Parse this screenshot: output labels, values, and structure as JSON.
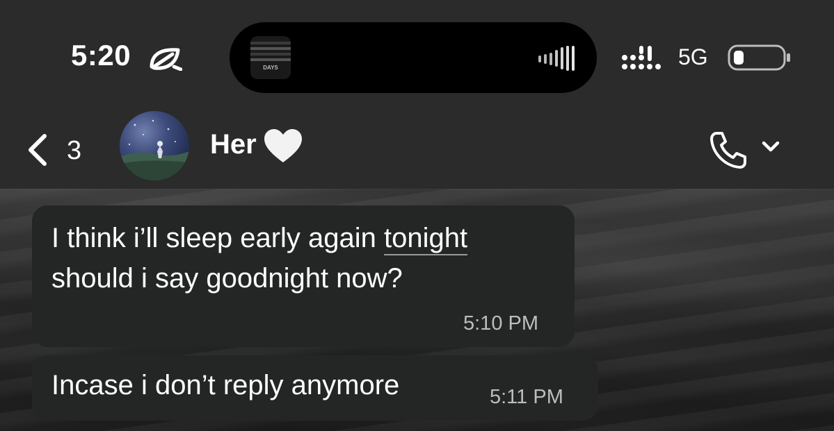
{
  "status_bar": {
    "time": "5:20",
    "network": "5G",
    "album_caption": "DAYS"
  },
  "header": {
    "back_count": "3",
    "contact_name": "Her",
    "icons": {
      "back": "chevron-left-icon",
      "heart": "white-heart-icon",
      "call": "phone-icon",
      "dropdown": "chevron-down-icon"
    }
  },
  "messages": [
    {
      "line1_prefix": "I think i’ll sleep early again ",
      "line1_link": "tonight",
      "line2": "should i say goodnight now?",
      "time": "5:10 PM"
    },
    {
      "text": "Incase i don’t reply anymore",
      "time": "5:11 PM"
    }
  ],
  "colors": {
    "header_bg": "#2b2b2b",
    "bubble_bg": "#242626",
    "timestamp": "#bdbdbd"
  }
}
